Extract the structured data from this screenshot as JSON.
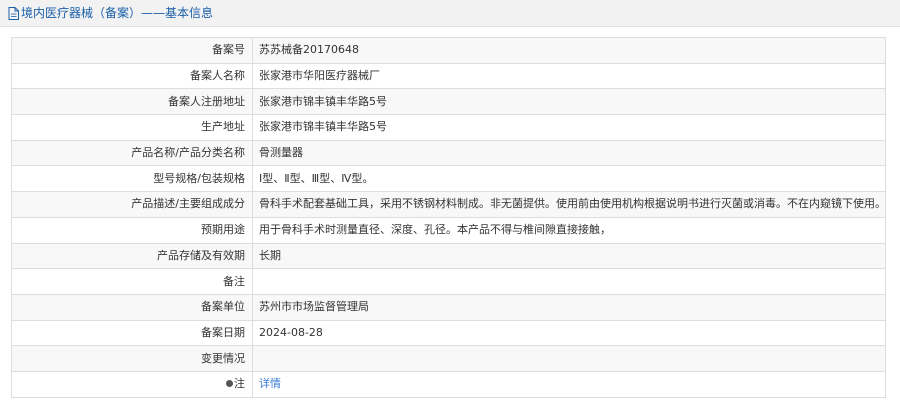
{
  "page_title": "境内医疗器械（备案）——基本信息",
  "title_icon": "document-icon",
  "rows": [
    {
      "label": "备案号",
      "value": "苏苏械备20170648"
    },
    {
      "label": "备案人名称",
      "value": "张家港市华阳医疗器械厂"
    },
    {
      "label": "备案人注册地址",
      "value": "张家港市锦丰镇丰华路5号"
    },
    {
      "label": "生产地址",
      "value": "张家港市锦丰镇丰华路5号"
    },
    {
      "label": "产品名称/产品分类名称",
      "value": "骨测量器"
    },
    {
      "label": "型号规格/包装规格",
      "value": "Ⅰ型、Ⅱ型、Ⅲ型、Ⅳ型。"
    },
    {
      "label": "产品描述/主要组成成分",
      "value": "骨科手术配套基础工具，采用不锈钢材料制成。非无菌提供。使用前由使用机构根据说明书进行灭菌或消毒。不在内窥镜下使用。"
    },
    {
      "label": "预期用途",
      "value": "用于骨科手术时测量直径、深度、孔径。本产品不得与椎间隙直接接触，"
    },
    {
      "label": "产品存储及有效期",
      "value": "长期"
    },
    {
      "label": "备注",
      "value": ""
    },
    {
      "label": "备案单位",
      "value": "苏州市市场监督管理局"
    },
    {
      "label": "备案日期",
      "value": "2024-08-28"
    },
    {
      "label": "变更情况",
      "value": ""
    },
    {
      "label": "注",
      "value": "详情",
      "label_icon": "bullet-icon"
    }
  ],
  "colors": {
    "title_text": "#1a5fa8",
    "link": "#3a7bd5",
    "row_alt": "#f8f8f8",
    "border": "#dddddd"
  }
}
